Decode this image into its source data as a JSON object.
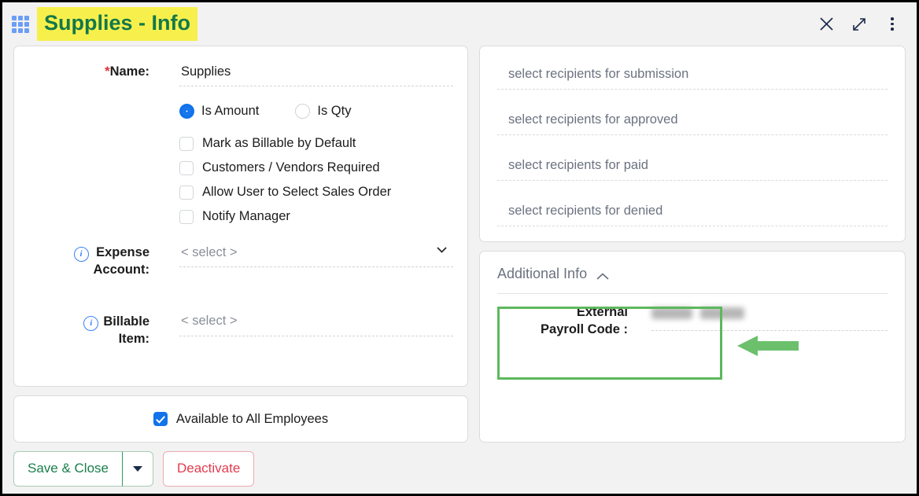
{
  "window": {
    "title": "Supplies - Info",
    "title_highlight_color": "#f7f04c",
    "title_text_color": "#13784a",
    "app_icon": "grid-icon",
    "controls": [
      {
        "name": "close-icon",
        "label": "Close"
      },
      {
        "name": "expand-icon",
        "label": "Expand"
      },
      {
        "name": "more-options-icon",
        "label": "More options"
      }
    ]
  },
  "form": {
    "name_field": {
      "label": "Name:",
      "required_marker": "*",
      "value": "Supplies",
      "placeholder": ""
    },
    "amount_type": {
      "options": [
        {
          "label": "Is Amount",
          "selected": true
        },
        {
          "label": "Is Qty",
          "selected": false
        }
      ]
    },
    "checkboxes": [
      {
        "label": "Mark as Billable by Default",
        "checked": false
      },
      {
        "label": "Customers / Vendors Required",
        "checked": false
      },
      {
        "label": "Allow User to Select Sales Order",
        "checked": false
      },
      {
        "label": "Notify Manager",
        "checked": false
      }
    ],
    "expense_account": {
      "label_line1": "Expense",
      "label_line2": "Account:",
      "info_icon": "info-icon",
      "value": "< select >",
      "has_dropdown": true
    },
    "billable_item": {
      "label_line1": "Billable",
      "label_line2": "Item:",
      "info_icon": "info-icon",
      "value": "< select >",
      "has_dropdown": false
    },
    "available_all": {
      "label": "Available to All Employees",
      "checked": true
    }
  },
  "recipients": {
    "rows": [
      {
        "placeholder": "select recipients for submission"
      },
      {
        "placeholder": "select recipients for approved"
      },
      {
        "placeholder": "select recipients for paid"
      },
      {
        "placeholder": "select recipients for denied"
      }
    ]
  },
  "additional_info": {
    "title": "Additional Info",
    "collapse_icon": "chevron-up-icon",
    "expanded": true,
    "payroll_code": {
      "label_line1": "External",
      "label_line2": "Payroll Code :",
      "value": "",
      "redacted": true
    },
    "annotation": {
      "box_color": "#5cb85c",
      "arrow_color": "#6cc06c",
      "arrow_direction": "left"
    }
  },
  "footer": {
    "save_label": "Save & Close",
    "save_color": "#1a7f4b",
    "dropdown_icon": "caret-down-icon",
    "deactivate_label": "Deactivate",
    "deactivate_color": "#e23b4e"
  }
}
